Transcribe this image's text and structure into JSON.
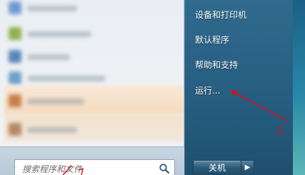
{
  "start_menu": {
    "right_panel": {
      "items": [
        {
          "label": "设备和打印机"
        },
        {
          "label": "默认程序"
        },
        {
          "label": "帮助和支持"
        },
        {
          "label": "运行..."
        }
      ],
      "shutdown_label": "关机",
      "shutdown_arrow": "▶"
    },
    "search": {
      "placeholder": "搜索程序和文件"
    }
  },
  "annotations": {
    "marker_label": "2",
    "color": "#e01010"
  },
  "icons": {
    "search": "magnifier-icon",
    "shutdown_options": "play-arrow-icon"
  }
}
